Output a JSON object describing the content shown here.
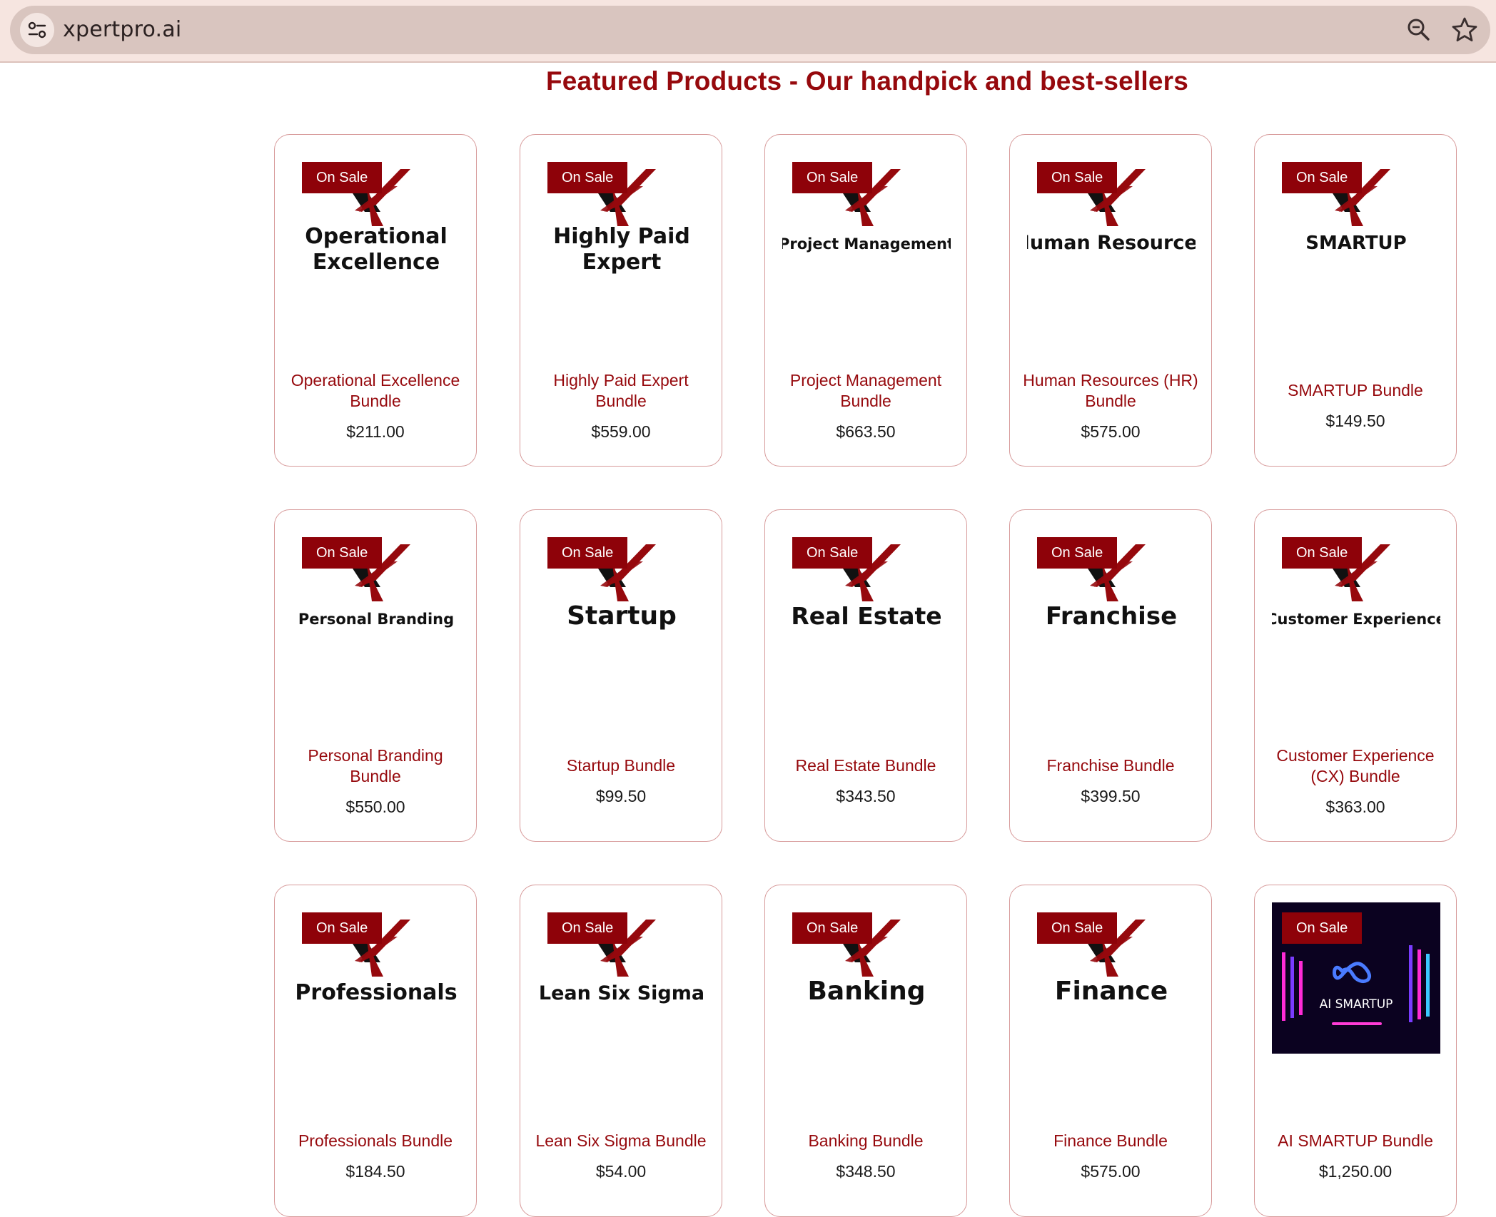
{
  "browser": {
    "url": "xpertpro.ai",
    "icons": [
      "site-info-icon",
      "zoom-icon",
      "bookmark-star-icon"
    ]
  },
  "page": {
    "heading": "Featured Products - Our handpick and best-sellers"
  },
  "colors": {
    "brand": "#96090d",
    "badge": "#8e0209",
    "card_border": "#d79a9a"
  },
  "products": [
    {
      "badge": "On Sale",
      "logo_text": [
        "Operational",
        "Excellence"
      ],
      "name": "Operational Excellence Bundle",
      "price": "$211.00"
    },
    {
      "badge": "On Sale",
      "logo_text": [
        "Highly Paid",
        "Expert"
      ],
      "name": "Highly Paid Expert Bundle",
      "price": "$559.00"
    },
    {
      "badge": "On Sale",
      "logo_text": [
        "Project Management"
      ],
      "name": "Project Management Bundle",
      "price": "$663.50"
    },
    {
      "badge": "On Sale",
      "logo_text": [
        "Human Resources"
      ],
      "name": "Human Resources (HR) Bundle",
      "price": "$575.00"
    },
    {
      "badge": "On Sale",
      "logo_text": [
        "SMARTUP"
      ],
      "name": "SMARTUP Bundle",
      "price": "$149.50"
    },
    {
      "badge": "On Sale",
      "logo_text": [
        "Personal Branding"
      ],
      "name": "Personal Branding Bundle",
      "price": "$550.00"
    },
    {
      "badge": "On Sale",
      "logo_text": [
        "Startup"
      ],
      "name": "Startup Bundle",
      "price": "$99.50"
    },
    {
      "badge": "On Sale",
      "logo_text": [
        "Real Estate"
      ],
      "name": "Real Estate Bundle",
      "price": "$343.50"
    },
    {
      "badge": "On Sale",
      "logo_text": [
        "Franchise"
      ],
      "name": "Franchise Bundle",
      "price": "$399.50"
    },
    {
      "badge": "On Sale",
      "logo_text": [
        "Customer Experience"
      ],
      "name": "Customer Experience (CX) Bundle",
      "price": "$363.00"
    },
    {
      "badge": "On Sale",
      "logo_text": [
        "Professionals"
      ],
      "name": "Professionals Bundle",
      "price": "$184.50"
    },
    {
      "badge": "On Sale",
      "logo_text": [
        "Lean Six Sigma"
      ],
      "name": "Lean Six Sigma Bundle",
      "price": "$54.00"
    },
    {
      "badge": "On Sale",
      "logo_text": [
        "Banking"
      ],
      "name": "Banking Bundle",
      "price": "$348.50"
    },
    {
      "badge": "On Sale",
      "logo_text": [
        "Finance"
      ],
      "name": "Finance Bundle",
      "price": "$575.00"
    },
    {
      "badge": "On Sale",
      "logo_text": [
        "AI SMARTUP"
      ],
      "name": "AI SMARTUP Bundle",
      "price": "$1,250.00",
      "image_style": "neon"
    }
  ]
}
